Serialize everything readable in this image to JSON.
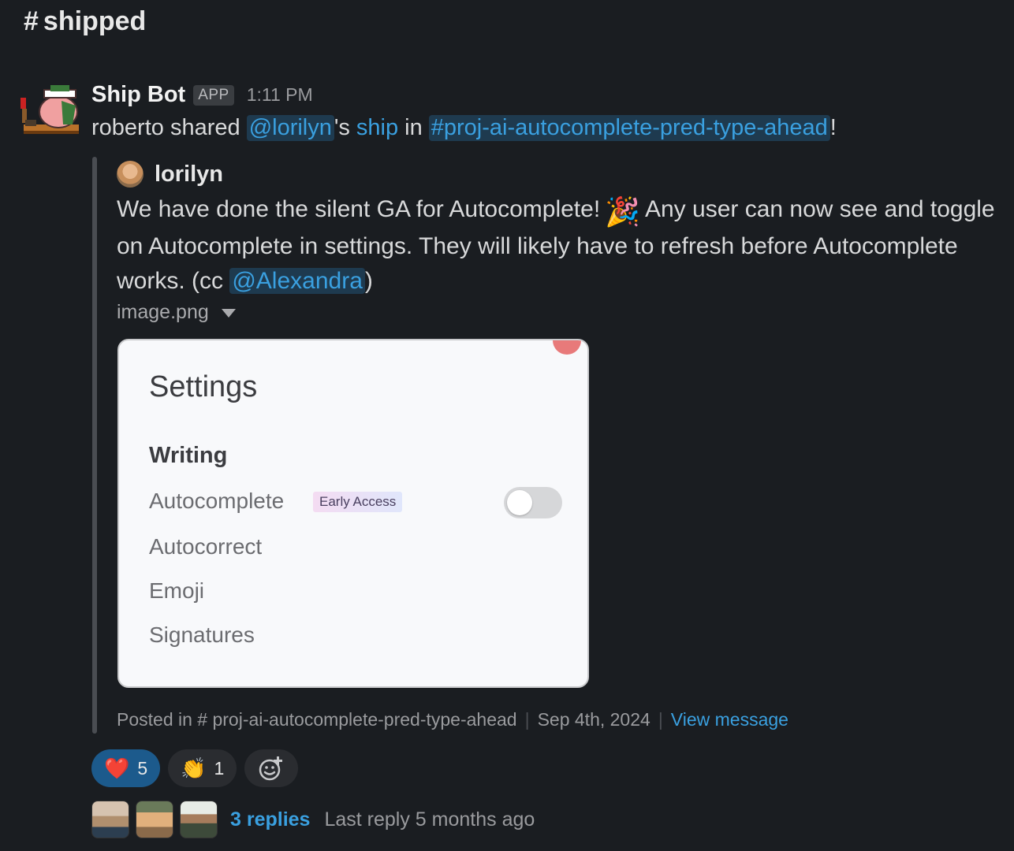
{
  "channel": {
    "name": "shipped"
  },
  "message": {
    "sender": "Ship Bot",
    "badge": "APP",
    "time": "1:11 PM",
    "text_pre": "roberto shared",
    "mention_user": "@lorilyn",
    "possessive": "'s",
    "ship_link": "ship",
    "in_word": "in",
    "channel_link": "#proj-ai-autocomplete-pred-type-ahead",
    "exclaim": "!"
  },
  "quote": {
    "author": "lorilyn",
    "text_1": "We have done the silent GA for Autocomplete!",
    "emoji": "🎉",
    "text_2": "Any user can now see and toggle on Autocomplete in settings. They will likely have to refresh before Autocomplete works. (cc",
    "mention": "@Alexandra",
    "text_3": ")"
  },
  "attachment": {
    "filename": "image.png",
    "preview": {
      "title": "Settings",
      "section": "Writing",
      "rows": [
        "Autocomplete",
        "Autocorrect",
        "Emoji",
        "Signatures"
      ],
      "pill": "Early Access"
    }
  },
  "footer": {
    "posted_in": "Posted in",
    "channel": "# proj-ai-autocomplete-pred-type-ahead",
    "date": "Sep 4th, 2024",
    "view": "View message"
  },
  "reactions": [
    {
      "emoji": "❤️",
      "count": "5",
      "active": true
    },
    {
      "emoji": "👏",
      "count": "1",
      "active": false
    }
  ],
  "thread": {
    "reply_count": "3 replies",
    "last_reply": "Last reply 5 months ago"
  }
}
